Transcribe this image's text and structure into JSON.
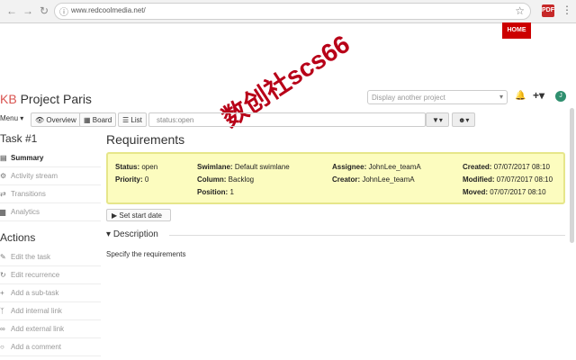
{
  "browser": {
    "url": "www.redcoolmedia.net/",
    "back_icon": "back-arrow-icon",
    "forward_icon": "forward-arrow-icon",
    "reload_icon": "reload-icon",
    "ext_label": "PDF"
  },
  "site": {
    "home_label": "HOME",
    "watermark": "数创社scs66"
  },
  "header": {
    "kb": "KB",
    "project": "Project Paris",
    "project_select_placeholder": "Display another project",
    "avatar_initial": "J"
  },
  "toolbar": {
    "menu_label": "Menu",
    "overview_label": "Overview",
    "board_label": "Board",
    "list_label": "List",
    "filter_value": "status:open"
  },
  "sidebar": {
    "task_heading": "Task #1",
    "task_items": [
      {
        "label": "Summary",
        "active": true
      },
      {
        "label": "Activity stream"
      },
      {
        "label": "Transitions"
      },
      {
        "label": "Analytics"
      }
    ],
    "actions_heading": "Actions",
    "action_items": [
      {
        "label": "Edit the task"
      },
      {
        "label": "Edit recurrence"
      },
      {
        "label": "Add a sub-task"
      },
      {
        "label": "Add internal link"
      },
      {
        "label": "Add external link"
      },
      {
        "label": "Add a comment"
      }
    ]
  },
  "main": {
    "title": "Requirements",
    "fields": {
      "status_label": "Status:",
      "status_value": "open",
      "priority_label": "Priority:",
      "priority_value": "0",
      "swimlane_label": "Swimlane:",
      "swimlane_value": "Default swimlane",
      "column_label": "Column:",
      "column_value": "Backlog",
      "position_label": "Position:",
      "position_value": "1",
      "assignee_label": "Assignee:",
      "assignee_value": "JohnLee_teamA",
      "creator_label": "Creator:",
      "creator_value": "JohnLee_teamA",
      "created_label": "Created:",
      "created_value": "07/07/2017 08:10",
      "modified_label": "Modified:",
      "modified_value": "07/07/2017 08:10",
      "moved_label": "Moved:",
      "moved_value": "07/07/2017 08:10"
    },
    "start_date_label": "Set start date",
    "description_heading": "Description",
    "description_text": "Specify the requirements"
  },
  "colors": {
    "info_box_bg": "#fcfcbf",
    "home_bg": "#cc0000",
    "watermark": "#b80018"
  }
}
